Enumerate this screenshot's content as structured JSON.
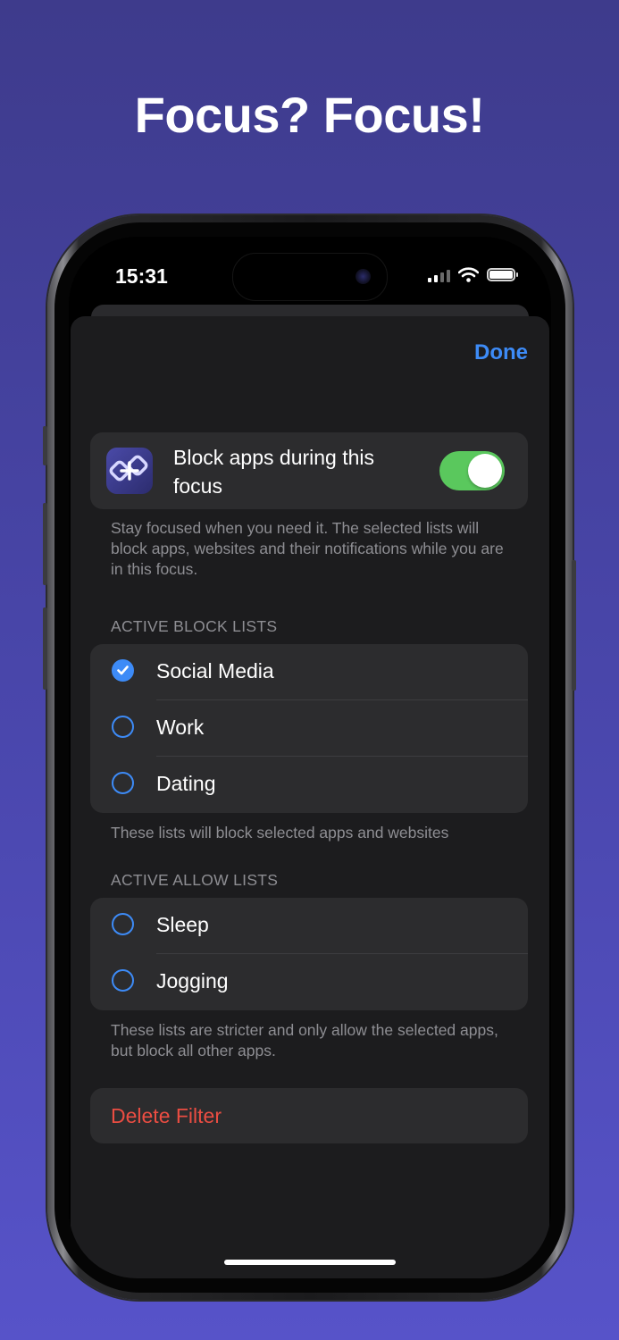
{
  "headline": "Focus? Focus!",
  "status_bar": {
    "time": "15:31",
    "icons": [
      "cellular-signal-icon",
      "wifi-icon",
      "battery-icon"
    ]
  },
  "nav": {
    "done_label": "Done"
  },
  "block_toggle": {
    "label": "Block apps during this focus",
    "is_on": true,
    "footnote": "Stay focused when you need it. The selected lists will block apps, websites and their notifications while you are in this focus."
  },
  "block_lists": {
    "header": "ACTIVE BLOCK LISTS",
    "items": [
      {
        "label": "Social Media",
        "checked": true
      },
      {
        "label": "Work",
        "checked": false
      },
      {
        "label": "Dating",
        "checked": false
      }
    ],
    "footnote": "These lists will block selected apps and websites"
  },
  "allow_lists": {
    "header": "ACTIVE ALLOW LISTS",
    "items": [
      {
        "label": "Sleep",
        "checked": false
      },
      {
        "label": "Jogging",
        "checked": false
      }
    ],
    "footnote": "These lists are stricter and only allow the selected apps, but block all other apps."
  },
  "delete_filter_label": "Delete Filter",
  "colors": {
    "accent": "#3d8bf7",
    "toggle_on": "#5ac85d",
    "destructive": "#eb4d42",
    "background_top": "#3e3b8c",
    "background_bottom": "#5753c9"
  }
}
